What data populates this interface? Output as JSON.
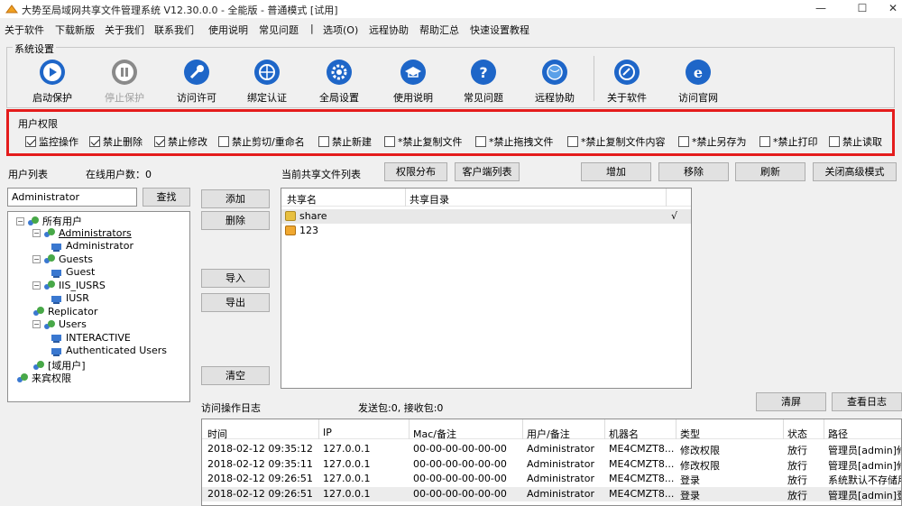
{
  "window": {
    "title": "大势至局域网共享文件管理系统 V12.30.0.0 - 全能版 - 普通模式 [试用]",
    "minimize": "—",
    "maximize": "☐",
    "close": "✕"
  },
  "menu": [
    "关于软件",
    "下载新版",
    "关于我们",
    "联系我们",
    "使用说明",
    "常见问题",
    "|",
    "选项(O)",
    "远程协助",
    "帮助汇总",
    "快速设置教程"
  ],
  "toolbar": {
    "group_label": "系统设置",
    "items": [
      {
        "label": "启动保护",
        "icon": "play-icon"
      },
      {
        "label": "停止保护",
        "icon": "pause-icon"
      },
      {
        "label": "访问许可",
        "icon": "key-icon"
      },
      {
        "label": "绑定认证",
        "icon": "globe-icon"
      },
      {
        "label": "全局设置",
        "icon": "gear-icon"
      },
      {
        "label": "使用说明",
        "icon": "graduation-cap-icon"
      },
      {
        "label": "常见问题",
        "icon": "question-icon"
      },
      {
        "label": "远程协助",
        "icon": "remote-globe-icon"
      },
      {
        "label": "关于软件",
        "icon": "software-icon"
      },
      {
        "label": "访问官网",
        "icon": "ie-icon"
      }
    ]
  },
  "permissions": {
    "group_label": "用户权限",
    "items": [
      {
        "label": "监控操作",
        "checked": true
      },
      {
        "label": "禁止删除",
        "checked": true
      },
      {
        "label": "禁止修改",
        "checked": true
      },
      {
        "label": "禁止剪切/重命名",
        "checked": false
      },
      {
        "label": "禁止新建",
        "checked": false
      },
      {
        "label": "*禁止复制文件",
        "checked": false
      },
      {
        "label": "*禁止拖拽文件",
        "checked": false
      },
      {
        "label": "*禁止复制文件内容",
        "checked": false
      },
      {
        "label": "*禁止另存为",
        "checked": false
      },
      {
        "label": "*禁止打印",
        "checked": false
      },
      {
        "label": "禁止读取",
        "checked": false
      }
    ]
  },
  "user_panel": {
    "title": "用户列表",
    "online_count": "在线用户数：0",
    "search_value": "Administrator",
    "search_button": "查找",
    "tree": [
      {
        "label": "所有用户",
        "level": 0,
        "type": "group",
        "expander": "⊟"
      },
      {
        "label": "Administrators",
        "level": 1,
        "type": "group",
        "expander": "⊟",
        "selected": true
      },
      {
        "label": "Administrator",
        "level": 2,
        "type": "user"
      },
      {
        "label": "Guests",
        "level": 1,
        "type": "group",
        "expander": "⊟"
      },
      {
        "label": "Guest",
        "level": 2,
        "type": "user"
      },
      {
        "label": "IIS_IUSRS",
        "level": 1,
        "type": "group",
        "expander": "⊟"
      },
      {
        "label": "IUSR",
        "level": 2,
        "type": "user"
      },
      {
        "label": "Replicator",
        "level": 1,
        "type": "group"
      },
      {
        "label": "Users",
        "level": 1,
        "type": "group",
        "expander": "⊟"
      },
      {
        "label": "INTERACTIVE",
        "level": 2,
        "type": "user"
      },
      {
        "label": "Authenticated Users",
        "level": 2,
        "type": "user"
      },
      {
        "label": "[域用户]",
        "level": 1,
        "type": "group"
      },
      {
        "label": "来宾权限",
        "level": 0,
        "type": "group"
      }
    ]
  },
  "middle_buttons": {
    "add": "添加",
    "delete": "删除",
    "import": "导入",
    "export": "导出",
    "clear": "清空"
  },
  "share_panel": {
    "title": "当前共享文件列表",
    "perm_dist": "权限分布",
    "client_list": "客户端列表",
    "add": "增加",
    "remove": "移除",
    "refresh": "刷新",
    "close_advanced": "关闭高级模式",
    "columns": [
      "共享名",
      "共享目录"
    ],
    "rows": [
      {
        "name": "share",
        "dir": "",
        "check": "√"
      },
      {
        "name": "123",
        "dir": "",
        "check": ""
      }
    ]
  },
  "log_panel": {
    "title": "访问操作日志",
    "packets": "发送包:0, 接收包:0",
    "clear_button": "清屏",
    "view_button": "查看日志",
    "columns": [
      "时间",
      "IP",
      "Mac/备注",
      "用户/备注",
      "机器名",
      "类型",
      "状态",
      "路径"
    ],
    "rows": [
      [
        "2018-02-12 09:35:12",
        "127.0.0.1",
        "00-00-00-00-00-00",
        "Administrator",
        "ME4CMZT8...",
        "修改权限",
        "放行",
        "管理员[admin]修"
      ],
      [
        "2018-02-12 09:35:11",
        "127.0.0.1",
        "00-00-00-00-00-00",
        "Administrator",
        "ME4CMZT8...",
        "修改权限",
        "放行",
        "管理员[admin]修"
      ],
      [
        "2018-02-12 09:26:51",
        "127.0.0.1",
        "00-00-00-00-00-00",
        "Administrator",
        "ME4CMZT8...",
        "登录",
        "放行",
        "系统默认不存储用"
      ],
      [
        "2018-02-12 09:26:51",
        "127.0.0.1",
        "00-00-00-00-00-00",
        "Administrator",
        "ME4CMZT8...",
        "登录",
        "放行",
        "管理员[admin]登"
      ]
    ]
  },
  "colors": {
    "highlight_border": "#e41c1c",
    "icon_blue": "#1e66c8",
    "icon_gray": "#8a8a8a"
  }
}
